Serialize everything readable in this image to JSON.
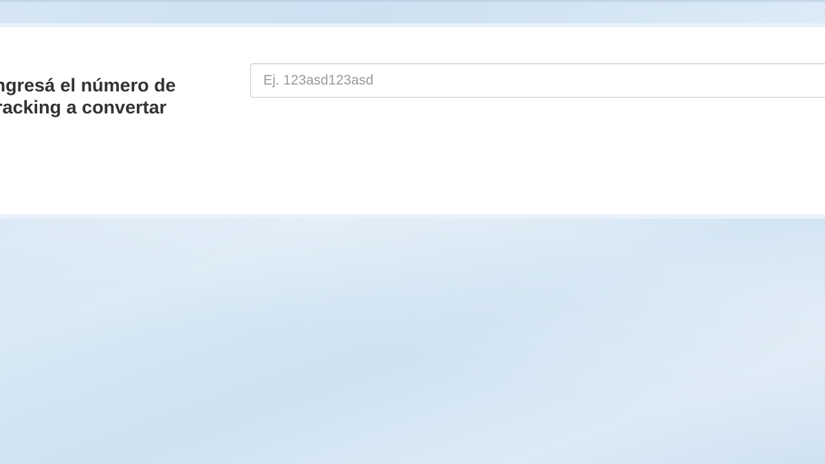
{
  "tracking_form": {
    "label": "Ingresá el número de tracking a convertar",
    "input_value": "",
    "input_placeholder": "Ej. 123asd123asd"
  }
}
